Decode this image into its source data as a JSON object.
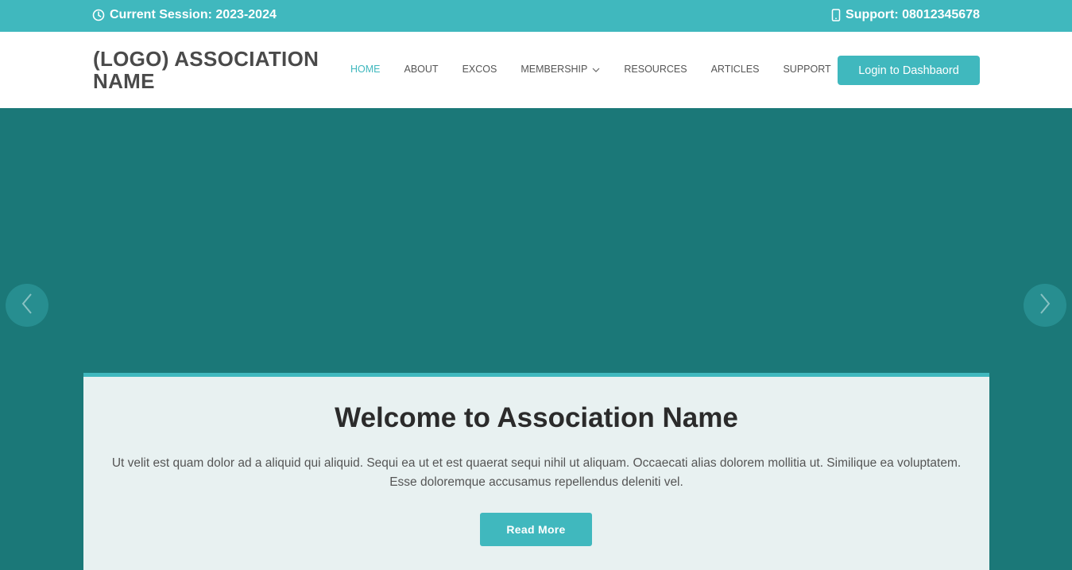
{
  "topbar": {
    "session": "Current Session: 2023-2024",
    "support": "Support: 08012345678",
    "session_icon": "clock-icon",
    "support_icon": "phone-icon"
  },
  "header": {
    "logo": "(LOGO) ASSOCIATION NAME",
    "nav": [
      {
        "label": "HOME",
        "active": true
      },
      {
        "label": "ABOUT"
      },
      {
        "label": "EXCOS"
      },
      {
        "label": "MEMBERSHIP",
        "dropdown": true
      },
      {
        "label": "RESOURCES"
      },
      {
        "label": "ARTICLES"
      },
      {
        "label": "SUPPORT"
      }
    ],
    "login_label": "Login to Dashbaord"
  },
  "hero": {
    "title": "Welcome to Association Name",
    "text": "Ut velit est quam dolor ad a aliquid qui aliquid. Sequi ea ut et est quaerat sequi nihil ut aliquam. Occaecati alias dolorem mollitia ut. Similique ea voluptatem. Esse doloremque accusamus repellendus deleniti vel.",
    "button": "Read More"
  },
  "colors": {
    "accent": "#40b8be",
    "hero_bg": "#1b7878",
    "card_bg": "#e8f1f1"
  }
}
